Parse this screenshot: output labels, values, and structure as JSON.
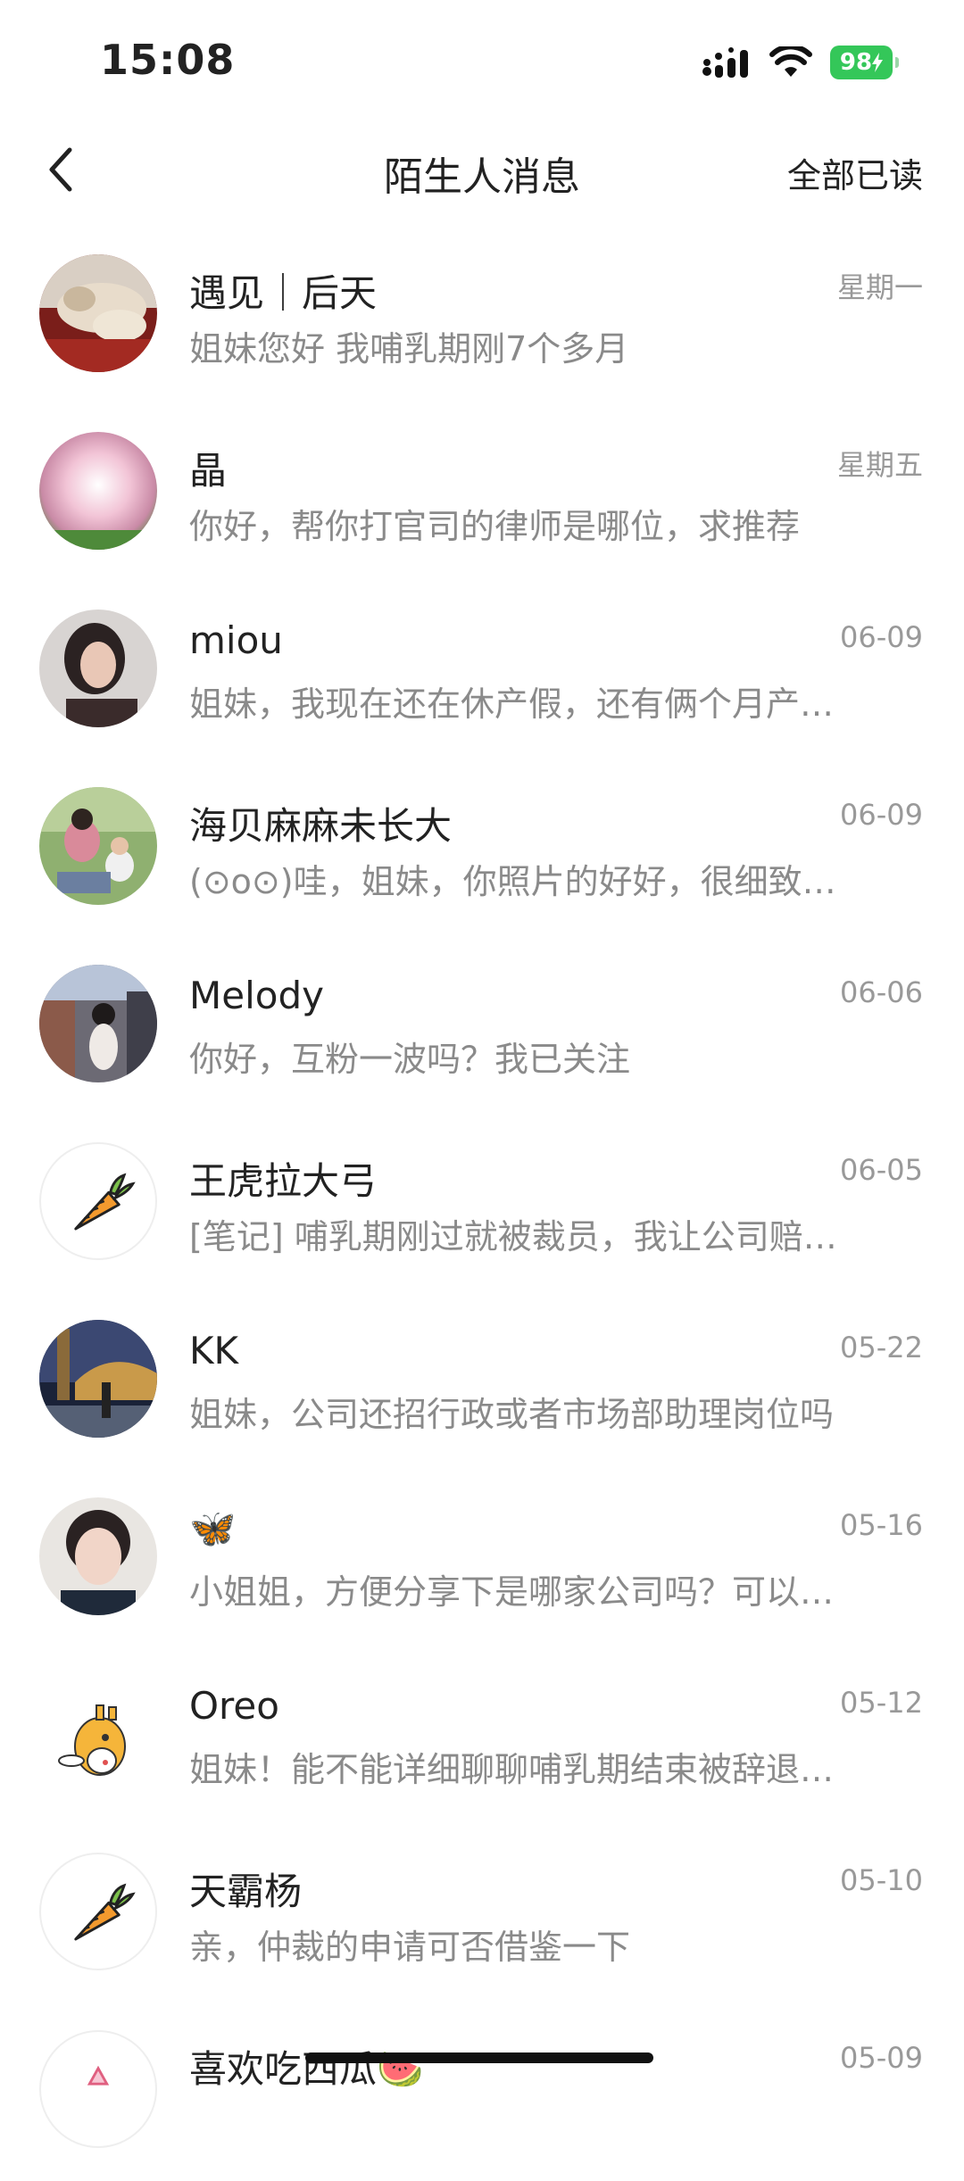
{
  "status_bar": {
    "time": "15:08",
    "battery": "98"
  },
  "header": {
    "title": "陌生人消息",
    "mark_all_read": "全部已读"
  },
  "messages": [
    {
      "name": "遇见｜后天",
      "time": "星期一",
      "preview": "姐妹您好 我哺乳期刚7个多月",
      "avatar": "photo-dog"
    },
    {
      "name": "晶",
      "time": "星期五",
      "preview": "你好，帮你打官司的律师是哪位，求推荐",
      "avatar": "photo-dandelion"
    },
    {
      "name": "miou",
      "time": "06-09",
      "preview": "姐妹，我现在还在休产假，还有俩个月产…",
      "avatar": "photo-woman"
    },
    {
      "name": "海贝麻麻未长大",
      "time": "06-09",
      "preview": "(⊙o⊙)哇，姐妹，你照片的好好，很细致…",
      "avatar": "photo-mother-child"
    },
    {
      "name": "Melody",
      "time": "06-06",
      "preview": "你好，互粉一波吗？我已关注",
      "avatar": "photo-street"
    },
    {
      "name": "王虎拉大弓",
      "time": "06-05",
      "preview": "[笔记] 哺乳期刚过就被裁员，我让公司赔…",
      "avatar": "carrot-icon"
    },
    {
      "name": "KK",
      "time": "05-22",
      "preview": "姐妹，公司还招行政或者市场部助理岗位吗",
      "avatar": "photo-night"
    },
    {
      "name": "🦋",
      "time": "05-16",
      "preview": "小姐姐，方便分享下是哪家公司吗？可以…",
      "avatar": "photo-girl"
    },
    {
      "name": "Oreo",
      "time": "05-12",
      "preview": "姐妹！能不能详细聊聊哺乳期结束被辞退…",
      "avatar": "giraffe-icon"
    },
    {
      "name": "天霸杨",
      "time": "05-10",
      "preview": "亲，仲裁的申请可否借鉴一下",
      "avatar": "carrot-icon"
    },
    {
      "name": "喜欢吃西瓜🍉",
      "time": "05-09",
      "preview": "",
      "avatar": "photo-pink"
    }
  ]
}
